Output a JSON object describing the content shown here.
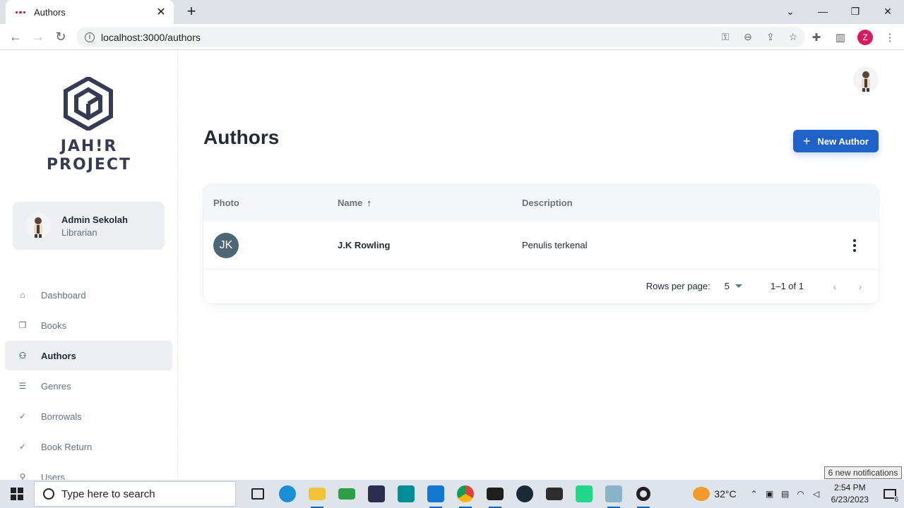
{
  "browser": {
    "tab_title": "Authors",
    "url": "localhost:3000/authors",
    "profile_initial": "Z"
  },
  "app": {
    "logo_line1": "JAH!R",
    "logo_line2": "PROJECT",
    "account": {
      "name": "Admin Sekolah",
      "role": "Librarian"
    },
    "nav": [
      {
        "label": "Dashboard",
        "icon": "home-icon",
        "active": false
      },
      {
        "label": "Books",
        "icon": "book-icon",
        "active": false
      },
      {
        "label": "Authors",
        "icon": "users-icon",
        "active": true
      },
      {
        "label": "Genres",
        "icon": "list-icon",
        "active": false
      },
      {
        "label": "Borrowals",
        "icon": "check-circle-icon",
        "active": false
      },
      {
        "label": "Book Return",
        "icon": "check-circle-icon",
        "active": false
      },
      {
        "label": "Users",
        "icon": "lock-icon",
        "active": false
      }
    ]
  },
  "page": {
    "title": "Authors",
    "new_button": "New Author",
    "accent": "#1f62c8"
  },
  "table": {
    "headers": {
      "photo": "Photo",
      "name": "Name",
      "description": "Description"
    },
    "sort": {
      "column": "name",
      "direction": "asc"
    },
    "rows": [
      {
        "initials": "JK",
        "name": "J.K Rowling",
        "description": "Penulis terkenal"
      }
    ],
    "pagination": {
      "rows_label": "Rows per page:",
      "rows_value": "5",
      "range": "1–1 of 1"
    }
  },
  "taskbar": {
    "search_placeholder": "Type here to search",
    "temperature": "32°C",
    "time": "2:54 PM",
    "date": "6/23/2023",
    "notification_tooltip": "6 new notifications",
    "notification_count": "6"
  }
}
